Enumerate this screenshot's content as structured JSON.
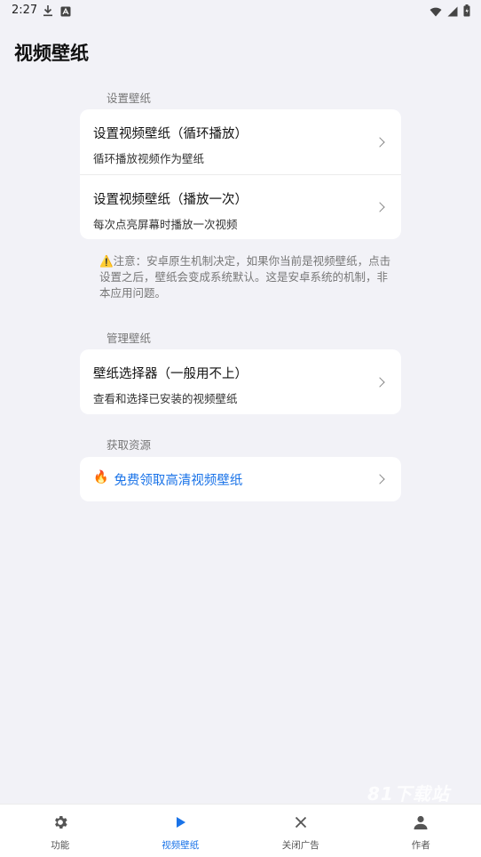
{
  "status_bar": {
    "time": "2:27"
  },
  "page": {
    "title": "视频壁纸"
  },
  "sections": {
    "set": {
      "label": "设置壁纸",
      "items": [
        {
          "title": "设置视频壁纸（循环播放）",
          "subtitle": "循环播放视频作为壁纸"
        },
        {
          "title": "设置视频壁纸（播放一次）",
          "subtitle": "每次点亮屏幕时播放一次视频"
        }
      ]
    },
    "notice": "⚠️注意：安卓原生机制决定，如果你当前是视频壁纸，点击设置之后，壁纸会变成系统默认。这是安卓系统的机制，非本应用问题。",
    "manage": {
      "label": "管理壁纸",
      "items": [
        {
          "title": "壁纸选择器（一般用不上）",
          "subtitle": "查看和选择已安装的视频壁纸"
        }
      ]
    },
    "resources": {
      "label": "获取资源",
      "link_icon": "🔥",
      "link_text": "免费领取高清视频壁纸"
    }
  },
  "watermark": "81下载站",
  "bottom_nav": {
    "items": [
      {
        "label": "功能",
        "icon": "gear-icon"
      },
      {
        "label": "视频壁纸",
        "icon": "play-icon",
        "active": true
      },
      {
        "label": "关闭广告",
        "icon": "close-icon"
      },
      {
        "label": "作者",
        "icon": "person-icon"
      }
    ]
  },
  "colors": {
    "accent": "#1a73e8",
    "background": "#f2f2f7",
    "card": "#ffffff"
  }
}
